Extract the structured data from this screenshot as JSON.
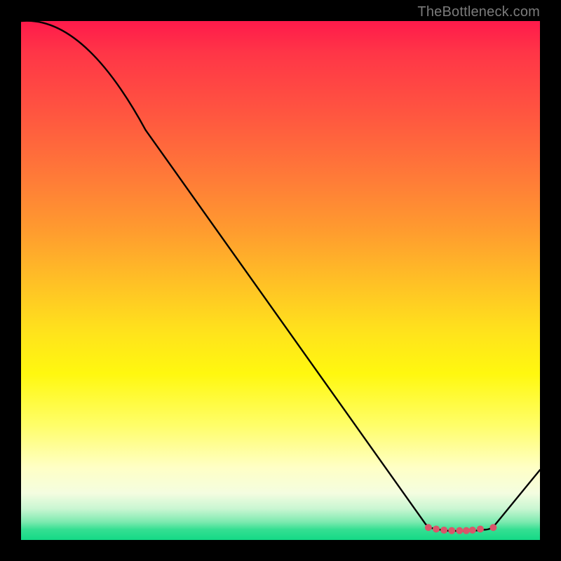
{
  "watermark": "TheBottleneck.com",
  "chart_data": {
    "type": "line",
    "title": "",
    "xlabel": "",
    "ylabel": "",
    "xlim": [
      0,
      1
    ],
    "ylim": [
      0,
      1
    ],
    "note": "Axes carry no tick labels; values below are normalized plot-area fractions (x right, y up) read from the image.",
    "series": [
      {
        "name": "curve",
        "points": [
          {
            "x": 0.0,
            "y": 1.0
          },
          {
            "x": 0.24,
            "y": 0.79
          },
          {
            "x": 0.78,
            "y": 0.03
          },
          {
            "x": 0.8,
            "y": 0.022
          },
          {
            "x": 0.83,
            "y": 0.018
          },
          {
            "x": 0.86,
            "y": 0.018
          },
          {
            "x": 0.89,
            "y": 0.02
          },
          {
            "x": 0.91,
            "y": 0.025
          },
          {
            "x": 1.0,
            "y": 0.135
          }
        ]
      }
    ],
    "markers": [
      {
        "x": 0.785,
        "y": 0.024
      },
      {
        "x": 0.8,
        "y": 0.021
      },
      {
        "x": 0.815,
        "y": 0.019
      },
      {
        "x": 0.83,
        "y": 0.018
      },
      {
        "x": 0.845,
        "y": 0.018
      },
      {
        "x": 0.858,
        "y": 0.018
      },
      {
        "x": 0.87,
        "y": 0.019
      },
      {
        "x": 0.885,
        "y": 0.021
      },
      {
        "x": 0.91,
        "y": 0.024
      }
    ],
    "marker_style": {
      "shape": "circle",
      "fill": "#d9566a",
      "radius_px": 5
    }
  }
}
